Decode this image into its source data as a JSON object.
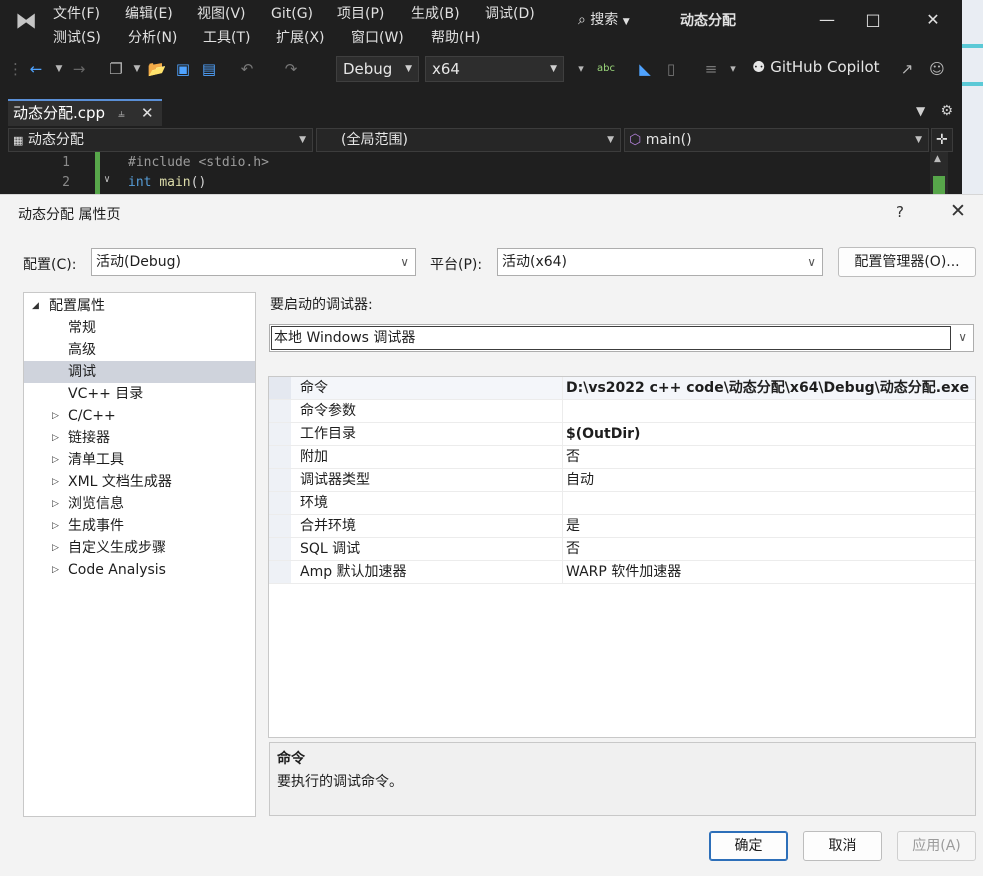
{
  "vs": {
    "menu_row1": [
      "文件(F)",
      "编辑(E)",
      "视图(V)",
      "Git(G)",
      "项目(P)",
      "生成(B)",
      "调试(D)"
    ],
    "menu_row2": [
      "测试(S)",
      "分析(N)",
      "工具(T)",
      "扩展(X)",
      "窗口(W)",
      "帮助(H)"
    ],
    "search_label": "搜索",
    "window_title": "动态分配",
    "config_value": "Debug",
    "platform_value": "x64",
    "copilot_label": "GitHub Copilot",
    "doc_tab": "动态分配.cpp",
    "nav_project": "动态分配",
    "nav_scope": "(全局范围)",
    "nav_member": "main()",
    "code_lines": [
      {
        "num": "1",
        "pre": "#include ",
        "rest": "<stdio.h>"
      },
      {
        "num": "2",
        "kw": "int ",
        "fn": "main",
        "rest": "()"
      }
    ]
  },
  "dialog": {
    "title": "动态分配 属性页",
    "help": "?",
    "config_label": "配置(C):",
    "config_value": "活动(Debug)",
    "platform_label": "平台(P):",
    "platform_value": "活动(x64)",
    "config_manager": "配置管理器(O)...",
    "tree": [
      {
        "label": "配置属性",
        "level": 0,
        "twisty": "expanded"
      },
      {
        "label": "常规",
        "level": 1,
        "twisty": "none"
      },
      {
        "label": "高级",
        "level": 1,
        "twisty": "none"
      },
      {
        "label": "调试",
        "level": 1,
        "twisty": "none",
        "selected": true
      },
      {
        "label": "VC++ 目录",
        "level": 1,
        "twisty": "none"
      },
      {
        "label": "C/C++",
        "level": 1,
        "twisty": "collapsed"
      },
      {
        "label": "链接器",
        "level": 1,
        "twisty": "collapsed"
      },
      {
        "label": "清单工具",
        "level": 1,
        "twisty": "collapsed"
      },
      {
        "label": "XML 文档生成器",
        "level": 1,
        "twisty": "collapsed"
      },
      {
        "label": "浏览信息",
        "level": 1,
        "twisty": "collapsed"
      },
      {
        "label": "生成事件",
        "level": 1,
        "twisty": "collapsed"
      },
      {
        "label": "自定义生成步骤",
        "level": 1,
        "twisty": "collapsed"
      },
      {
        "label": "Code Analysis",
        "level": 1,
        "twisty": "collapsed"
      }
    ],
    "debugger_label": "要启动的调试器:",
    "debugger_value": "本地 Windows 调试器",
    "properties": [
      {
        "name": "命令",
        "value": "D:\\vs2022 c++ code\\动态分配\\x64\\Debug\\动态分配.exe",
        "bold": true
      },
      {
        "name": "命令参数",
        "value": "",
        "bold": false
      },
      {
        "name": "工作目录",
        "value": "$(OutDir)",
        "bold": true
      },
      {
        "name": "附加",
        "value": "否",
        "bold": false
      },
      {
        "name": "调试器类型",
        "value": "自动",
        "bold": false
      },
      {
        "name": "环境",
        "value": "",
        "bold": false
      },
      {
        "name": "合并环境",
        "value": "是",
        "bold": false
      },
      {
        "name": "SQL 调试",
        "value": "否",
        "bold": false
      },
      {
        "name": "Amp 默认加速器",
        "value": "WARP 软件加速器",
        "bold": false
      }
    ],
    "desc_title": "命令",
    "desc_text": "要执行的调试命令。",
    "ok": "确定",
    "cancel": "取消",
    "apply": "应用(A)"
  }
}
